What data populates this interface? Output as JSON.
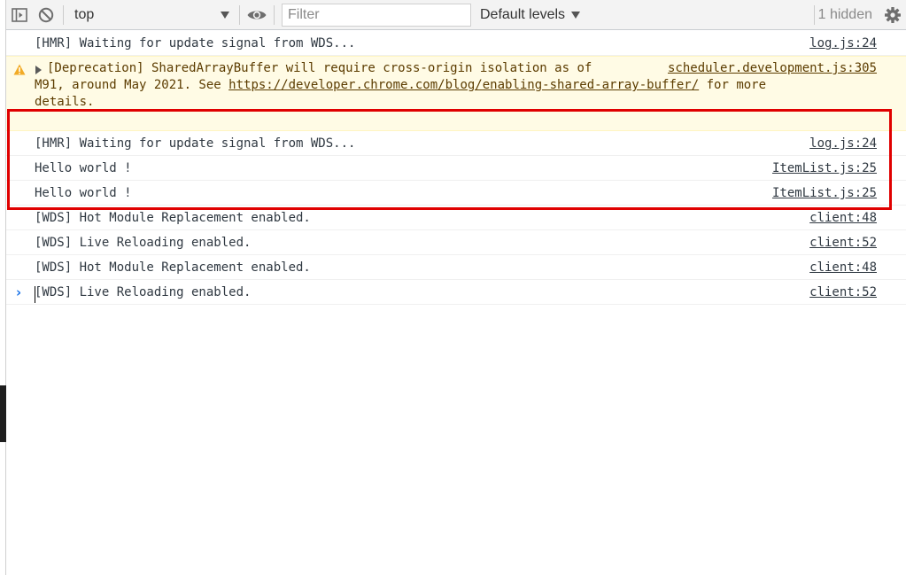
{
  "toolbar": {
    "context": "top",
    "filter_placeholder": "Filter",
    "levels_label": "Default levels",
    "hidden_count": "1 hidden"
  },
  "icons": {
    "sidebar_toggle": "sidebar-toggle-icon",
    "clear": "clear-console-icon",
    "live_expression": "eye-icon",
    "settings": "gear-icon",
    "warning": "warning-triangle-icon"
  },
  "messages": [
    {
      "text": "[HMR] Waiting for update signal from WDS...",
      "source": "log.js:24"
    },
    {
      "type": "warning",
      "line1_prefix": "[Deprecation] SharedArrayBuffer will require cross-origin isolation as of",
      "line2_prefix": "M91, around May 2021. See ",
      "link": "https://developer.chrome.com/blog/enabling-shared-array-buffer/",
      "line2_suffix": " for more",
      "line3": "details.",
      "source": "scheduler.development.js:305"
    },
    {
      "text": "[HMR] Waiting for update signal from WDS...",
      "source": "log.js:24"
    },
    {
      "text": "Hello world !",
      "source": "ItemList.js:25"
    },
    {
      "text": "Hello world !",
      "source": "ItemList.js:25"
    },
    {
      "text": "[WDS] Hot Module Replacement enabled.",
      "source": "client:48"
    },
    {
      "text": "[WDS] Live Reloading enabled.",
      "source": "client:52"
    },
    {
      "text": "[WDS] Hot Module Replacement enabled.",
      "source": "client:48"
    },
    {
      "text": "[WDS] Live Reloading enabled.",
      "source": "client:52"
    }
  ],
  "colors": {
    "highlight": "#e00000",
    "warning_bg": "#fffbe5",
    "warning_text": "#5c3c00",
    "prompt": "#1a73e8"
  }
}
